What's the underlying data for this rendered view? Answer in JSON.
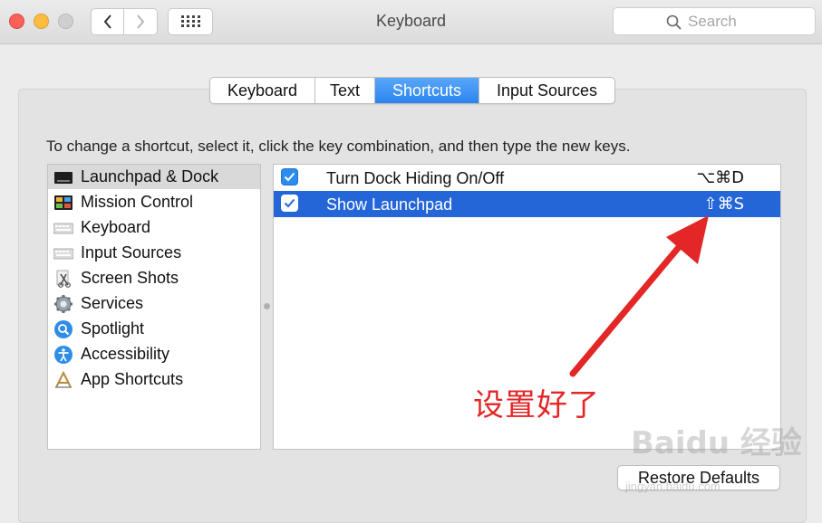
{
  "window": {
    "title": "Keyboard",
    "search_placeholder": "Search"
  },
  "toolbar": {
    "back_icon": "chevron-left-icon",
    "forward_icon": "chevron-right-icon",
    "grid_icon": "show-all-grid-icon"
  },
  "tabs": [
    {
      "label": "Keyboard",
      "active": false
    },
    {
      "label": "Text",
      "active": false
    },
    {
      "label": "Shortcuts",
      "active": true
    },
    {
      "label": "Input Sources",
      "active": false
    }
  ],
  "instructions": "To change a shortcut, select it, click the key combination, and then type the new keys.",
  "categories": [
    {
      "label": "Launchpad & Dock",
      "icon": "launchpad-dock-icon",
      "selected": true
    },
    {
      "label": "Mission Control",
      "icon": "mission-control-icon",
      "selected": false
    },
    {
      "label": "Keyboard",
      "icon": "keyboard-icon",
      "selected": false
    },
    {
      "label": "Input Sources",
      "icon": "input-sources-icon",
      "selected": false
    },
    {
      "label": "Screen Shots",
      "icon": "screen-shots-icon",
      "selected": false
    },
    {
      "label": "Services",
      "icon": "services-gear-icon",
      "selected": false
    },
    {
      "label": "Spotlight",
      "icon": "spotlight-icon",
      "selected": false
    },
    {
      "label": "Accessibility",
      "icon": "accessibility-icon",
      "selected": false
    },
    {
      "label": "App Shortcuts",
      "icon": "app-shortcuts-icon",
      "selected": false
    }
  ],
  "shortcuts": [
    {
      "label": "Turn Dock Hiding On/Off",
      "keys": "⌥⌘D",
      "checked": true,
      "selected": false
    },
    {
      "label": "Show Launchpad",
      "keys": "⇧⌘S",
      "checked": true,
      "selected": true
    }
  ],
  "annotation": {
    "text": "设置好了",
    "color": "#e32626"
  },
  "restore_button": "Restore Defaults",
  "watermark": {
    "main": "Baidu 经验",
    "sub": "jingyan.baidu.com"
  },
  "colors": {
    "accent": "#2a84f0",
    "selection": "#2466d8",
    "close": "#fc605b",
    "minimize": "#fdbc40"
  }
}
